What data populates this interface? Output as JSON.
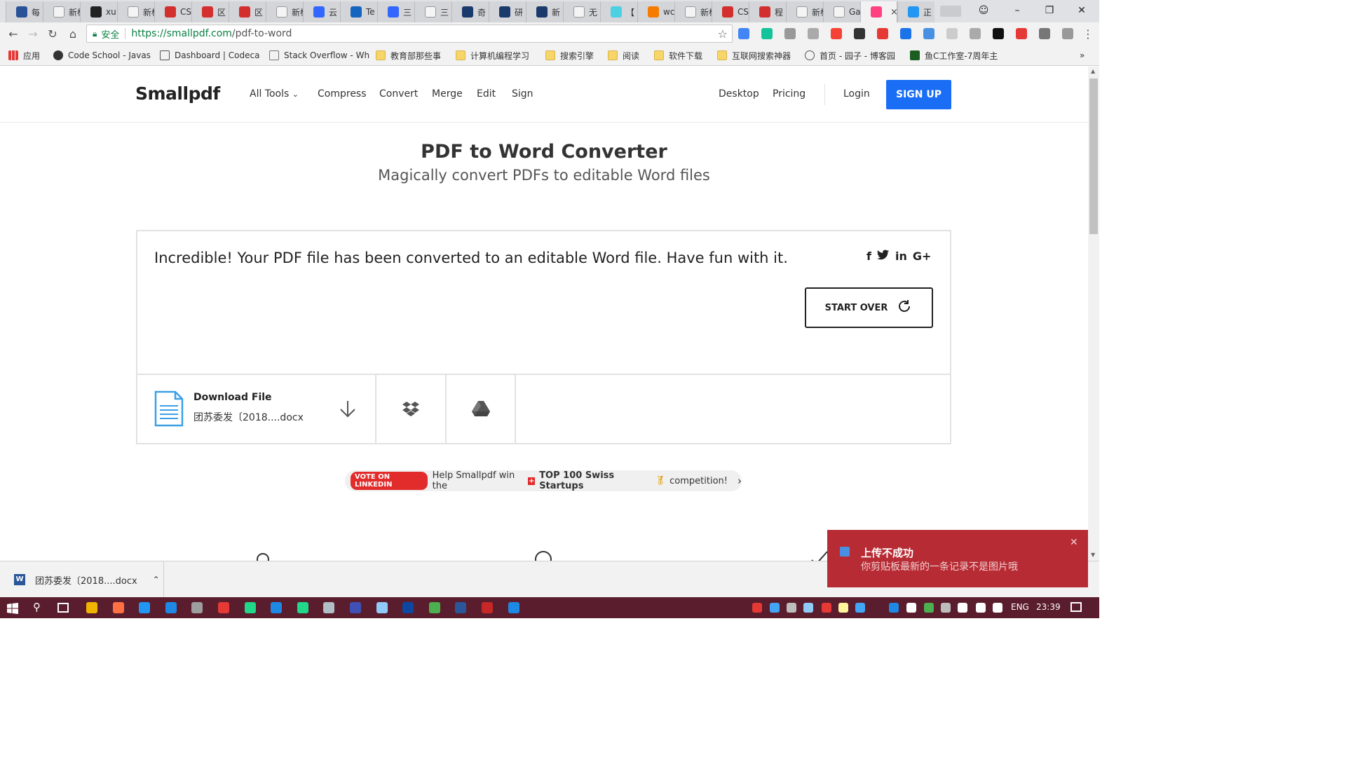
{
  "browser": {
    "tabs": [
      {
        "label": "每",
        "color": "#2a5298"
      },
      {
        "label": "新标签",
        "color": ""
      },
      {
        "label": "xu",
        "color": "#222222"
      },
      {
        "label": "新标签",
        "color": ""
      },
      {
        "label": "CS",
        "color": "#d32f2f"
      },
      {
        "label": "区",
        "color": "#d32f2f"
      },
      {
        "label": "区",
        "color": "#d32f2f"
      },
      {
        "label": "新标签",
        "color": ""
      },
      {
        "label": "云",
        "color": "#3366ff"
      },
      {
        "label": "Te",
        "color": "#1565c0"
      },
      {
        "label": "三",
        "color": "#3366ff"
      },
      {
        "label": "三",
        "color": ""
      },
      {
        "label": "奇",
        "color": "#1a3a6b"
      },
      {
        "label": "研",
        "color": "#1a3a6b"
      },
      {
        "label": "新",
        "color": "#1a3a6b"
      },
      {
        "label": "无",
        "color": ""
      },
      {
        "label": "【",
        "color": "#4dd0e1"
      },
      {
        "label": "wc",
        "color": "#f57c00"
      },
      {
        "label": "新标签",
        "color": ""
      },
      {
        "label": "CS",
        "color": "#d32f2f"
      },
      {
        "label": "程",
        "color": "#d32f2f"
      },
      {
        "label": "新标签",
        "color": ""
      },
      {
        "label": "Ga",
        "color": ""
      },
      {
        "label": "",
        "color": "#ff4081",
        "active": true
      },
      {
        "label": "正",
        "color": "#2196f3"
      }
    ],
    "omnibox": {
      "lock_icon": "lock-icon",
      "secure_label": "安全",
      "url_scheme_host": "https://smallpdf.com",
      "url_path": "/pdf-to-word"
    },
    "bookmarks": [
      {
        "label": "应用",
        "icon": "apps-grid-icon"
      },
      {
        "label": "Code School - Javas",
        "icon": "codeschool-icon"
      },
      {
        "label": "Dashboard | Codeca",
        "icon": "codecademy-icon"
      },
      {
        "label": "Stack Overflow - Wh",
        "icon": "page-icon"
      },
      {
        "label": "教育部那些事",
        "icon": "folder-icon"
      },
      {
        "label": "计算机编程学习",
        "icon": "folder-icon"
      },
      {
        "label": "搜索引擎",
        "icon": "folder-icon"
      },
      {
        "label": "阅读",
        "icon": "folder-icon"
      },
      {
        "label": "软件下载",
        "icon": "folder-icon"
      },
      {
        "label": "互联网搜索神器",
        "icon": "folder-icon"
      },
      {
        "label": "首页 - 园子 - 博客园",
        "icon": "cnblogs-icon"
      },
      {
        "label": "鱼C工作室-7周年主",
        "icon": "fishc-icon"
      }
    ]
  },
  "site": {
    "logo": "Smallpdf",
    "nav_left": [
      "All Tools",
      "Compress",
      "Convert",
      "Merge",
      "Edit",
      "Sign"
    ],
    "nav_right": [
      "Desktop",
      "Pricing"
    ],
    "login": "Login",
    "signup": "SIGN UP",
    "title": "PDF to Word Converter",
    "subtitle": "Magically convert PDFs to editable Word files",
    "result_message": "Incredible! Your PDF file has been converted to an editable Word file. Have fun with it.",
    "share": [
      "f",
      "t",
      "in",
      "G+"
    ],
    "start_over": "START OVER",
    "download_title": "Download File",
    "download_filename": "团苏委发〔2018....docx",
    "vote_badge": "VOTE ON LINKEDIN",
    "vote_text_1": "Help Smallpdf win the",
    "vote_text_bold": "TOP 100 Swiss Startups",
    "vote_text_2": "competition!"
  },
  "download_bar": {
    "filename": "团苏委发〔2018....docx"
  },
  "toast": {
    "title": "上传不成功",
    "message": "你剪贴板最新的一条记录不是图片哦"
  },
  "taskbar": {
    "lang": "ENG",
    "time": "23:39"
  },
  "colors": {
    "accent": "#1a6ef5",
    "toast_bg": "#b72b34",
    "vote_red": "#e22b2b",
    "taskbar": "#5a1d2d"
  }
}
